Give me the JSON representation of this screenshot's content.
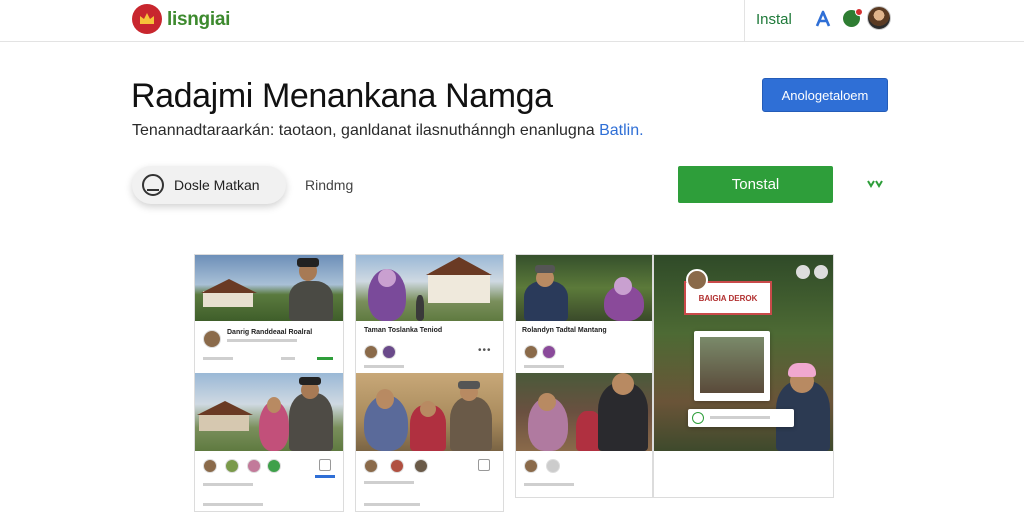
{
  "topbar": {
    "brand": "lisngiai",
    "install_label": "Instal"
  },
  "header": {
    "title": "Radajmi Menankana Namga",
    "cta_label": "Anologetaloem",
    "subtitle": "Tenannadtaraarkán: taotaon, ganldanat ilasnuthánngh enanlugna",
    "subtitle_link": "Batlin."
  },
  "actions": {
    "pill_label": "Dosle Matkan",
    "rating_label": "Rindmg",
    "install_label": "Tonstal"
  },
  "gallery": {
    "shot1": {
      "row1_title": "Danrig Randdeaal Roalral",
      "row2_title": ""
    },
    "shot2": {
      "row1_title": "Taman Toslanka Teniod"
    },
    "shot3": {
      "row1_title": "Rolandyn Tadtal Mantang"
    },
    "shot4": {
      "sign_text": "BAIGIA DEROK"
    }
  },
  "colors": {
    "brand_green": "#3d8a2e",
    "cta_blue": "#2f6fd6",
    "install_green": "#2e9e3a",
    "logo_red": "#c8262e"
  }
}
